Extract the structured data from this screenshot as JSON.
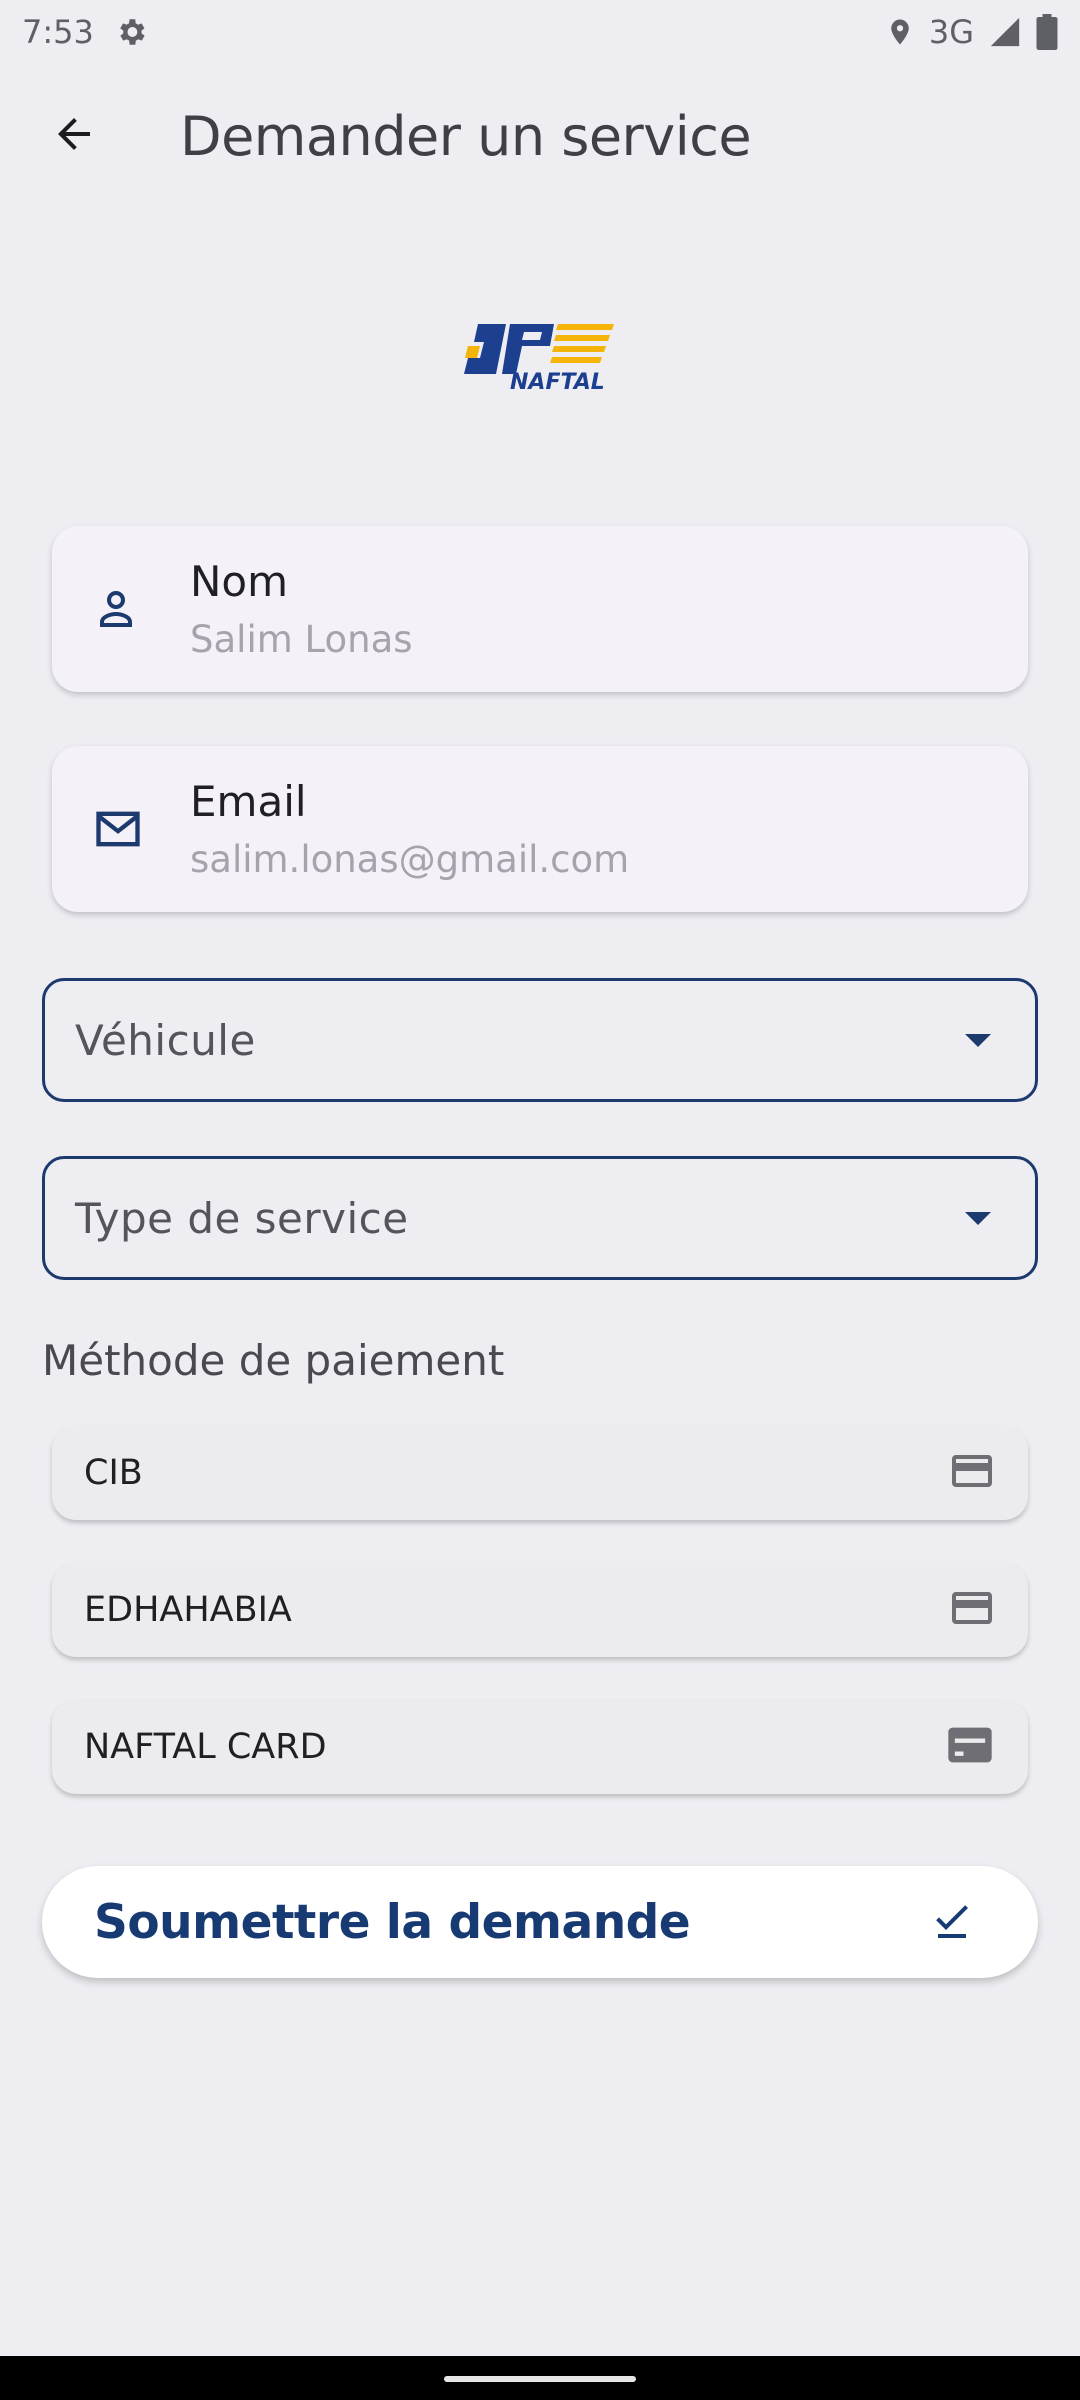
{
  "status_bar": {
    "time": "7:53",
    "network": "3G",
    "icons": [
      "settings-icon",
      "location-icon",
      "signal-icon",
      "battery-icon"
    ]
  },
  "app_bar": {
    "back_icon": "arrow-back-icon",
    "title": "Demander un service"
  },
  "logo": {
    "name": "naftal-logo",
    "text": "NAFTAL",
    "colors": {
      "blue": "#1d3f8f",
      "yellow": "#f5b40a"
    }
  },
  "user_info": {
    "name": {
      "label": "Nom",
      "value": "Salim Lonas",
      "icon": "person-icon"
    },
    "email": {
      "label": "Email",
      "value": "salim.lonas@gmail.com",
      "icon": "mail-icon"
    }
  },
  "form": {
    "vehicle_dropdown": {
      "placeholder": "Véhicule",
      "icon": "dropdown-arrow-icon"
    },
    "service_type_dropdown": {
      "placeholder": "Type de service",
      "icon": "dropdown-arrow-icon"
    }
  },
  "payment": {
    "title": "Méthode de paiement",
    "options": [
      {
        "label": "CIB",
        "icon": "credit-card-icon"
      },
      {
        "label": "EDHAHABIA",
        "icon": "credit-card-icon"
      },
      {
        "label": "NAFTAL CARD",
        "icon": "card-filled-icon"
      }
    ]
  },
  "submit": {
    "label": "Soumettre la demande",
    "icon": "check-icon"
  },
  "colors": {
    "background": "#eeedf2",
    "primary": "#1d3a6e",
    "accent_text": "#173a72",
    "card_bg": "#f5f1f8"
  }
}
